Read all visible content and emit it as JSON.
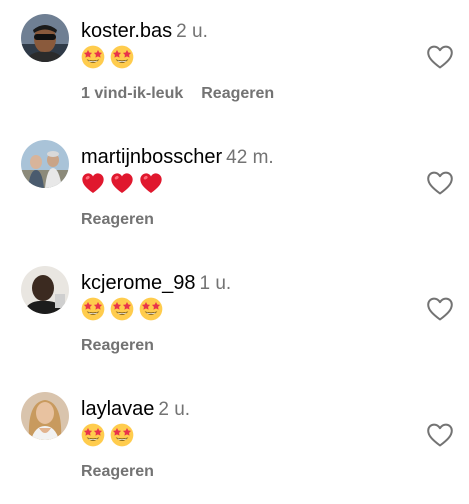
{
  "comments": [
    {
      "username": "koster.bas",
      "time": "2 u.",
      "emoji": "star-struck",
      "emoji_count": 2,
      "likes": "1 vind-ik-leuk",
      "reply_label": "Reageren"
    },
    {
      "username": "martijnbosscher",
      "time": "42 m.",
      "emoji": "red-heart",
      "emoji_count": 3,
      "likes": "",
      "reply_label": "Reageren"
    },
    {
      "username": "kcjerome_98",
      "time": "1 u.",
      "emoji": "star-struck",
      "emoji_count": 3,
      "likes": "",
      "reply_label": "Reageren"
    },
    {
      "username": "laylavae",
      "time": "2 u.",
      "emoji": "star-struck",
      "emoji_count": 2,
      "likes": "",
      "reply_label": "Reageren"
    }
  ],
  "colors": {
    "text": "#000000",
    "secondary": "#737373",
    "heart_outline": "#737373",
    "emoji_face": "#FFCC4D",
    "emoji_eye_star": "#E8344B",
    "emoji_heart": "#E0182E"
  },
  "icons": {
    "like": "heart-outline-icon",
    "star-struck": "star-eyes-emoji",
    "red-heart": "red-heart-emoji"
  }
}
